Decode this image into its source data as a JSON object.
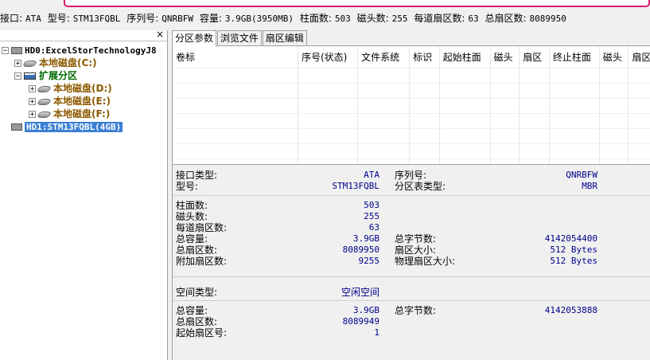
{
  "infobar": {
    "interface_label": "接口:",
    "interface_value": "ATA",
    "model_label": "型号:",
    "model_value": "STM13FQBL",
    "serial_label": "序列号:",
    "serial_value": "QNRBFW",
    "capacity_label": "容量:",
    "capacity_value": "3.9GB(3950MB)",
    "cylinders_label": "柱面数:",
    "cylinders_value": "503",
    "heads_label": "磁头数:",
    "heads_value": "255",
    "spt_label": "每道扇区数:",
    "spt_value": "63",
    "total_sectors_label": "总扇区数:",
    "total_sectors_value": "8089950"
  },
  "tree": {
    "close": "×",
    "hd0": "HD0:ExcelStorTechnologyJ8",
    "c": "本地磁盘(C:)",
    "extended": "扩展分区",
    "d": "本地磁盘(D:)",
    "e": "本地磁盘(E:)",
    "f": "本地磁盘(F:)",
    "hd1": "HD1:STM13FQBL(4GB)"
  },
  "tabs": [
    "分区参数",
    "浏览文件",
    "扇区编辑"
  ],
  "table": {
    "columns": [
      "卷标",
      "序号(状态)",
      "文件系统",
      "标识",
      "起始柱面",
      "磁头",
      "扇区",
      "终止柱面",
      "磁头",
      "扇区"
    ]
  },
  "info": {
    "iface_type_label": "接口类型:",
    "iface_type_value": "ATA",
    "model_label": "型号:",
    "model_value": "STM13FQBL",
    "serial_label": "序列号:",
    "serial_value": "QNRBFW",
    "pt_type_label": "分区表类型:",
    "pt_type_value": "MBR",
    "cyl_label": "柱面数:",
    "cyl_value": "503",
    "heads_label": "磁头数:",
    "heads_value": "255",
    "spt_label": "每道扇区数:",
    "spt_value": "63",
    "cap_label": "总容量:",
    "cap_value": "3.9GB",
    "bytes_label": "总字节数:",
    "bytes_value": "4142054400",
    "sectors_label": "总扇区数:",
    "sectors_value": "8089950",
    "sector_size_label": "扇区大小:",
    "sector_size_value": "512 Bytes",
    "extra_label": "附加扇区数:",
    "extra_value": "9255",
    "phys_label": "物理扇区大小:",
    "phys_value": "512 Bytes",
    "space_type_label": "空间类型:",
    "space_type_value": "空闲空间",
    "cap2_label": "总容量:",
    "cap2_value": "3.9GB",
    "bytes2_label": "总字节数:",
    "bytes2_value": "4142053888",
    "sectors2_label": "总扇区数:",
    "sectors2_value": "8089949",
    "start_label": "起始扇区号:",
    "start_value": "1"
  }
}
